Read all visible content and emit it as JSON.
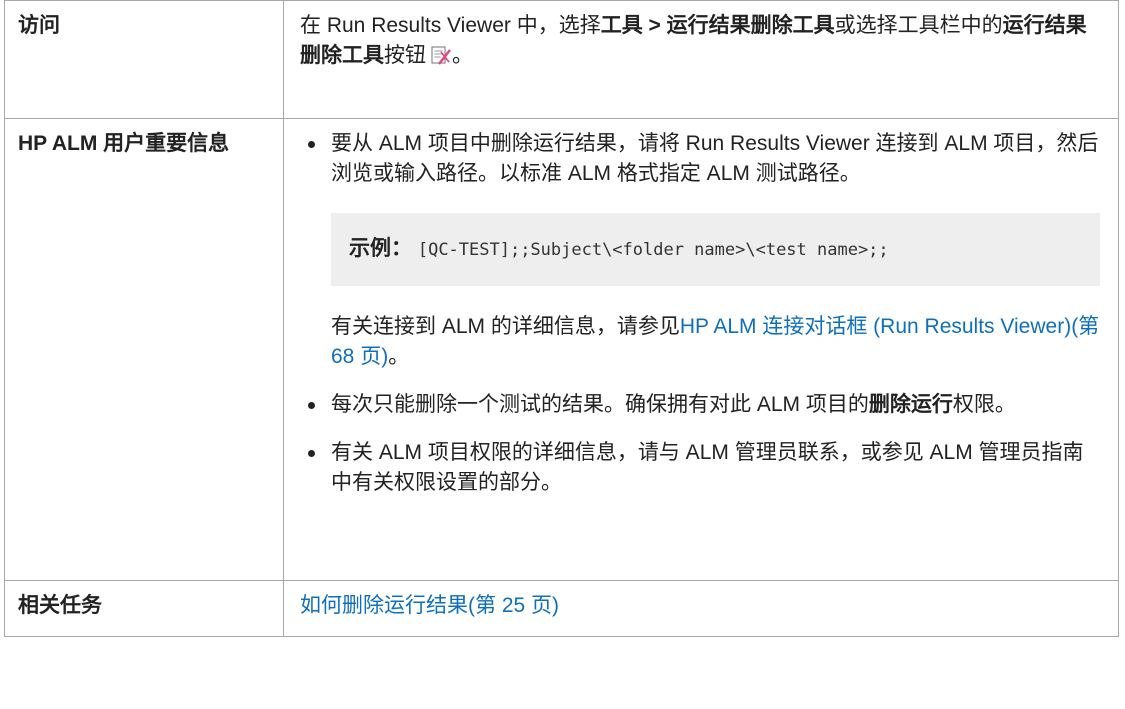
{
  "access": {
    "label": "访问",
    "p1": "在 Run Results Viewer 中，选择",
    "menu_path": "工具 > 运行结果删除工具",
    "p2": "或选择工具栏中的",
    "tool_name": "运行结果删除工具",
    "p3": "按钮",
    "p4": "。",
    "icon": "run-results-deletion-tool-icon"
  },
  "alm": {
    "label": "HP ALM 用户重要信息",
    "bullet1": "要从 ALM 项目中删除运行结果，请将 Run Results Viewer 连接到 ALM 项目，然后浏览或输入路径。以标准 ALM 格式指定 ALM 测试路径。",
    "example_label": "示例：",
    "example_code": "[QC-TEST];;Subject\\<folder name>\\<test name>;;",
    "see_prefix": "有关连接到 ALM 的详细信息，请参见",
    "see_link": "HP ALM 连接对话框 (Run Results Viewer)(第 68 页)",
    "see_suffix": "。",
    "bullet2_pre": "每次只能删除一个测试的结果。确保拥有对此 ALM 项目的",
    "bullet2_bold": "删除运行",
    "bullet2_post": "权限。",
    "bullet3": "有关 ALM 项目权限的详细信息，请与 ALM 管理员联系，或参见 ALM 管理员指南中有关权限设置的部分。"
  },
  "tasks": {
    "label": "相关任务",
    "link": "如何删除运行结果(第 25 页)"
  },
  "colors": {
    "link": "#0f6fbf",
    "border": "#a8a8a8",
    "example_bg": "#eeeeee"
  }
}
